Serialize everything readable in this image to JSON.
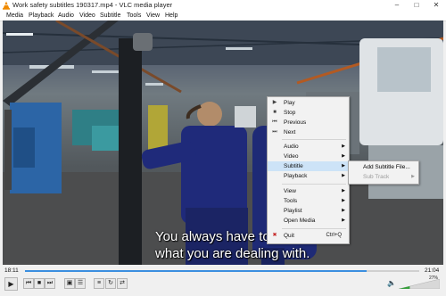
{
  "window": {
    "title": "Work safety subtitles 190317.mp4 - VLC media player"
  },
  "menubar": [
    "Media",
    "Playback",
    "Audio",
    "Video",
    "Subtitle",
    "Tools",
    "View",
    "Help"
  ],
  "video": {
    "subtitle_line1": "You always have to k",
    "subtitle_line2": "what you are dealing with."
  },
  "context_menu": {
    "play": "Play",
    "stop": "Stop",
    "previous": "Previous",
    "next": "Next",
    "audio": "Audio",
    "video": "Video",
    "subtitle": "Subtitle",
    "playback": "Playback",
    "view": "View",
    "tools": "Tools",
    "playlist": "Playlist",
    "open_media": "Open Media",
    "quit": "Quit",
    "quit_shortcut": "Ctrl+Q"
  },
  "submenu": {
    "add_subtitle": "Add Subtitle File...",
    "sub_track": "Sub Track"
  },
  "controls": {
    "elapsed": "18:11",
    "total": "21:04",
    "progress": 0.867,
    "volume_label": "27%",
    "volume": 0.27
  },
  "colors": {
    "accent": "#3b8fe0",
    "menu_highlight": "#cde3f7",
    "vlc_orange": "#f08a00"
  }
}
